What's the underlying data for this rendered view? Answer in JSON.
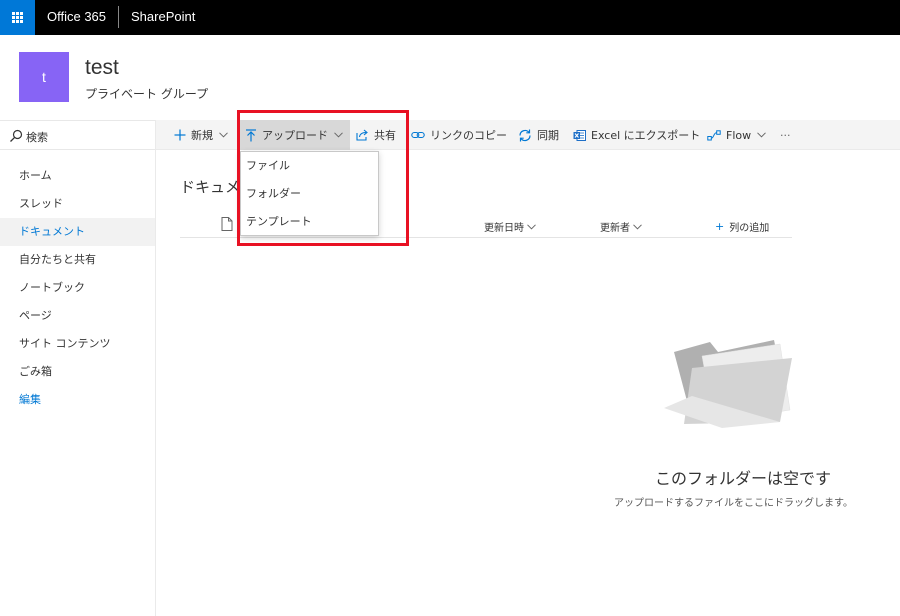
{
  "suitebar": {
    "brand": "Office 365",
    "app_name": "SharePoint"
  },
  "site": {
    "logo_letter": "t",
    "title": "test",
    "subtitle": "プライベート グループ"
  },
  "search": {
    "label": "検索"
  },
  "nav": {
    "items": [
      {
        "label": "ホーム"
      },
      {
        "label": "スレッド"
      },
      {
        "label": "ドキュメント"
      },
      {
        "label": "自分たちと共有"
      },
      {
        "label": "ノートブック"
      },
      {
        "label": "ページ"
      },
      {
        "label": "サイト コンテンツ"
      },
      {
        "label": "ごみ箱"
      },
      {
        "label": "編集"
      }
    ]
  },
  "commandbar": {
    "new_label": "新規",
    "upload_label": "アップロード",
    "share_label": "共有",
    "copy_link_label": "リンクのコピー",
    "sync_label": "同期",
    "export_excel_label": "Excel にエクスポート",
    "flow_label": "Flow",
    "more_label": "···"
  },
  "upload_menu": {
    "items": [
      {
        "label": "ファイル"
      },
      {
        "label": "フォルダー"
      },
      {
        "label": "テンプレート"
      }
    ]
  },
  "library": {
    "title": "ドキュメント",
    "columns": {
      "modified": "更新日時",
      "modified_by": "更新者",
      "add_column": "列の追加"
    }
  },
  "empty_state": {
    "title": "このフォルダーは空です",
    "subtitle": "アップロードするファイルをここにドラッグします。"
  },
  "colors": {
    "suitebar": "#000000",
    "waffle": "#0078d7",
    "site_logo": "#8764f5",
    "accent": "#0078d4",
    "highlight": "#e81123"
  }
}
